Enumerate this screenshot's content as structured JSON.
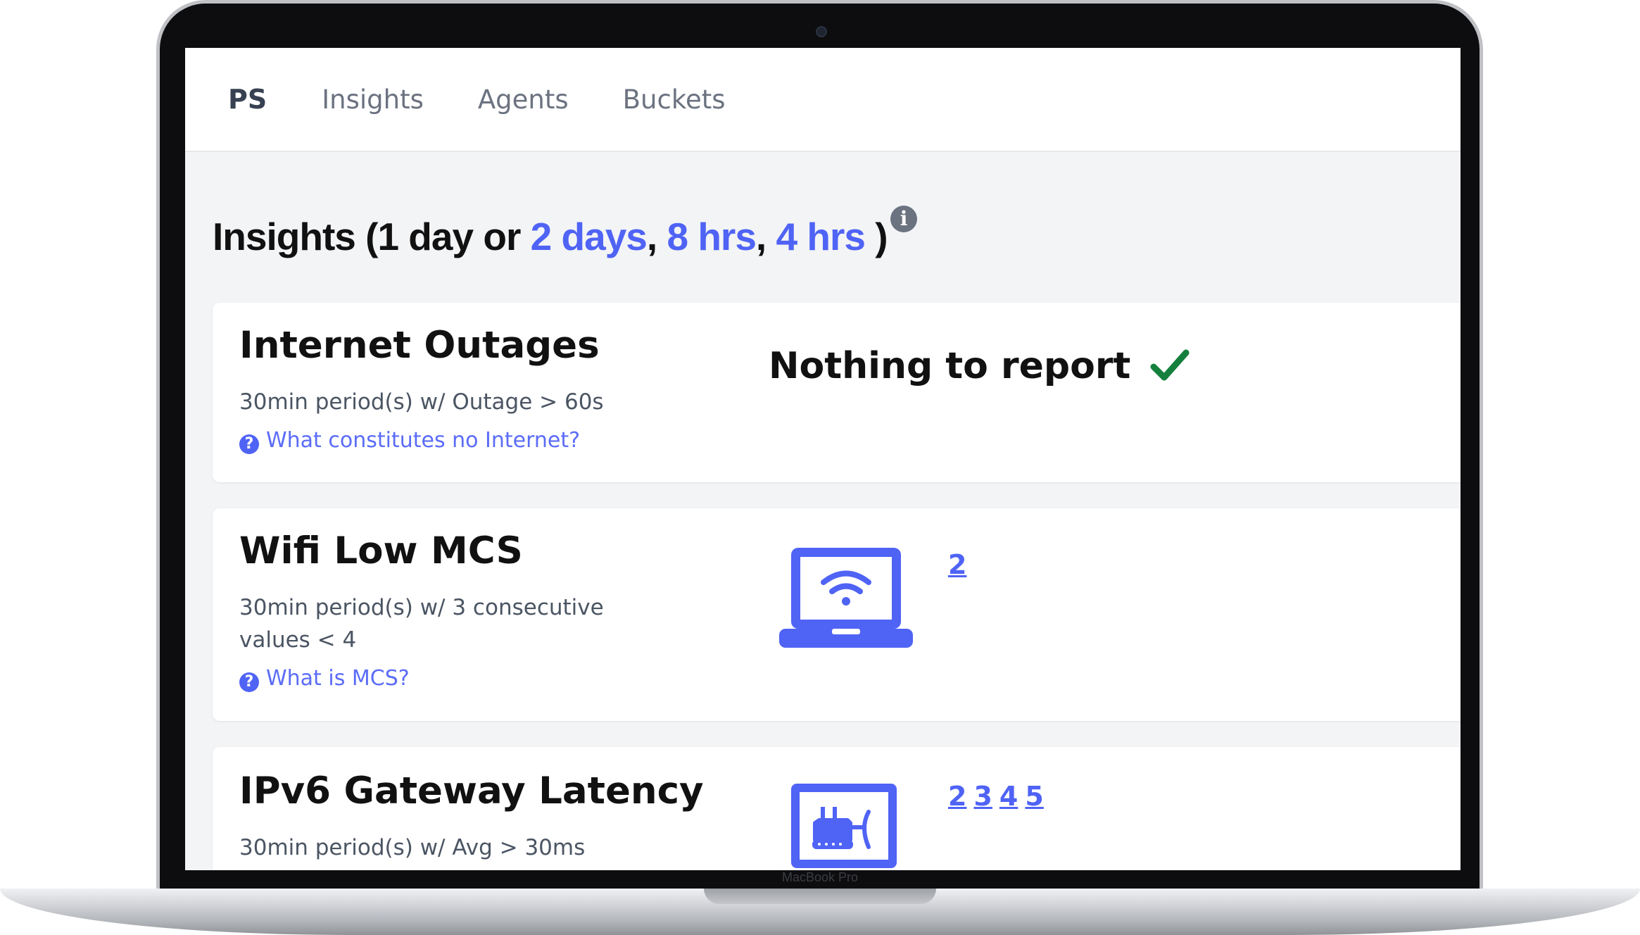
{
  "device": {
    "model_label": "MacBook Pro"
  },
  "nav": {
    "brand": "PS",
    "links": [
      "Insights",
      "Agents",
      "Buckets"
    ]
  },
  "heading": {
    "prefix": "Insights (1 day or",
    "ranges": [
      "2 days",
      "8 hrs",
      "4 hrs"
    ],
    "separator": ",",
    "close": ")",
    "info_icon": "info-icon"
  },
  "cards": [
    {
      "title": "Internet Outages",
      "subtitle": "30min period(s) w/ Outage > 60s",
      "help": "What constitutes no Internet?",
      "status": "Nothing to report",
      "status_icon": "check-icon"
    },
    {
      "title": "Wifi Low MCS",
      "subtitle": "30min period(s) w/ 3 consecutive values < 4",
      "help": "What is MCS?",
      "device_icon": "laptop-wifi-icon",
      "agents": [
        "2"
      ]
    },
    {
      "title": "IPv6 Gateway Latency",
      "subtitle": "30min period(s) w/ Avg > 30ms",
      "device_icon": "gateway-icon",
      "agents": [
        "2",
        "3",
        "4",
        "5"
      ]
    }
  ],
  "colors": {
    "accent": "#4f63f5",
    "success": "#15803d"
  }
}
